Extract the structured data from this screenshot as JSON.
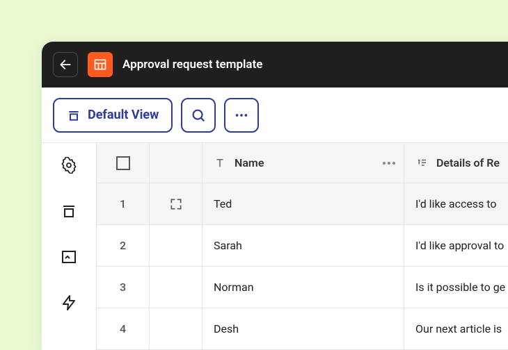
{
  "titlebar": {
    "title": "Approval request template"
  },
  "toolbar": {
    "view_label": "Default View"
  },
  "columns": {
    "name": "Name",
    "details": "Details of Re"
  },
  "rows": [
    {
      "num": "1",
      "name": "Ted",
      "details": "I'd like access to "
    },
    {
      "num": "2",
      "name": "Sarah",
      "details": "I'd like approval to"
    },
    {
      "num": "3",
      "name": "Norman",
      "details": "Is it possible to ge"
    },
    {
      "num": "4",
      "name": "Desh",
      "details": "Our next article is"
    }
  ]
}
